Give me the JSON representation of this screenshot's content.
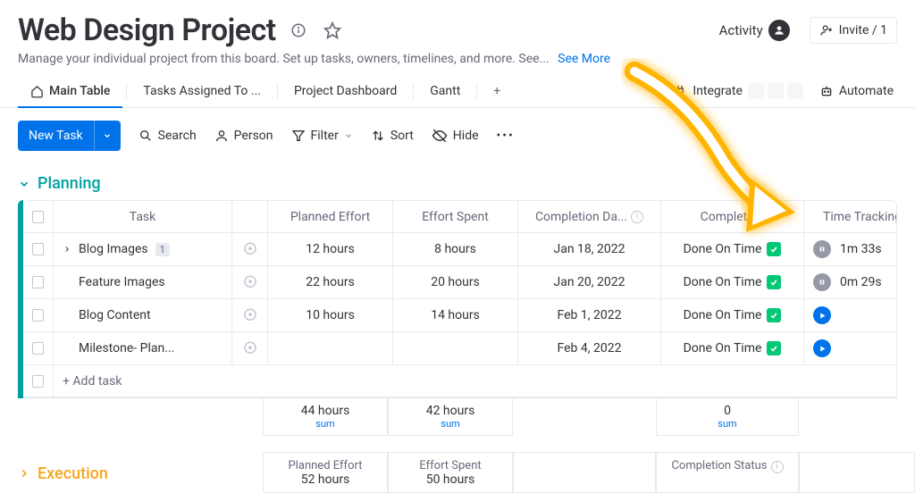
{
  "header": {
    "title": "Web Design Project",
    "subtitle": "Manage your individual project from this board. Set up tasks, owners, timelines, and more. See...",
    "see_more": "See More",
    "activity_label": "Activity",
    "invite_label": "Invite / 1"
  },
  "tabs": {
    "items": [
      "Main Table",
      "Tasks Assigned To ...",
      "Project Dashboard",
      "Gantt"
    ],
    "active": 0,
    "integrate": "Integrate",
    "automate": "Automate"
  },
  "toolbar": {
    "new_task": "New Task",
    "search": "Search",
    "person": "Person",
    "filter": "Filter",
    "sort": "Sort",
    "hide": "Hide"
  },
  "groups": {
    "planning": {
      "name": "Planning",
      "columns": [
        "Task",
        "Planned Effort",
        "Effort Spent",
        "Completion Da...",
        "Completion",
        "Time Tracking"
      ],
      "rows": [
        {
          "task": "Blog Images",
          "subcount": "1",
          "has_sub": true,
          "planned": "12 hours",
          "spent": "8 hours",
          "date": "Jan 18, 2022",
          "status": "Done On Time",
          "time": "1m 33s",
          "time_state": "pause"
        },
        {
          "task": "Feature Images",
          "planned": "22 hours",
          "spent": "20 hours",
          "date": "Jan 20, 2022",
          "status": "Done On Time",
          "time": "0m 29s",
          "time_state": "pause"
        },
        {
          "task": "Blog Content",
          "planned": "10 hours",
          "spent": "14 hours",
          "date": "Feb 1, 2022",
          "status": "Done On Time",
          "time": "",
          "time_state": "play"
        },
        {
          "task": "Milestone- Plan...",
          "planned": "",
          "spent": "",
          "date": "Feb 4, 2022",
          "status": "Done On Time",
          "time": "",
          "time_state": "play"
        }
      ],
      "add_task": "+ Add task",
      "sums": {
        "planned": "44 hours",
        "spent": "42 hours",
        "completion": "0",
        "label": "sum"
      }
    },
    "execution": {
      "name": "Execution",
      "columns": [
        "Planned Effort",
        "Effort Spent",
        "",
        "Completion Status"
      ],
      "sums": {
        "planned": "52 hours",
        "spent": "50 hours"
      }
    }
  }
}
